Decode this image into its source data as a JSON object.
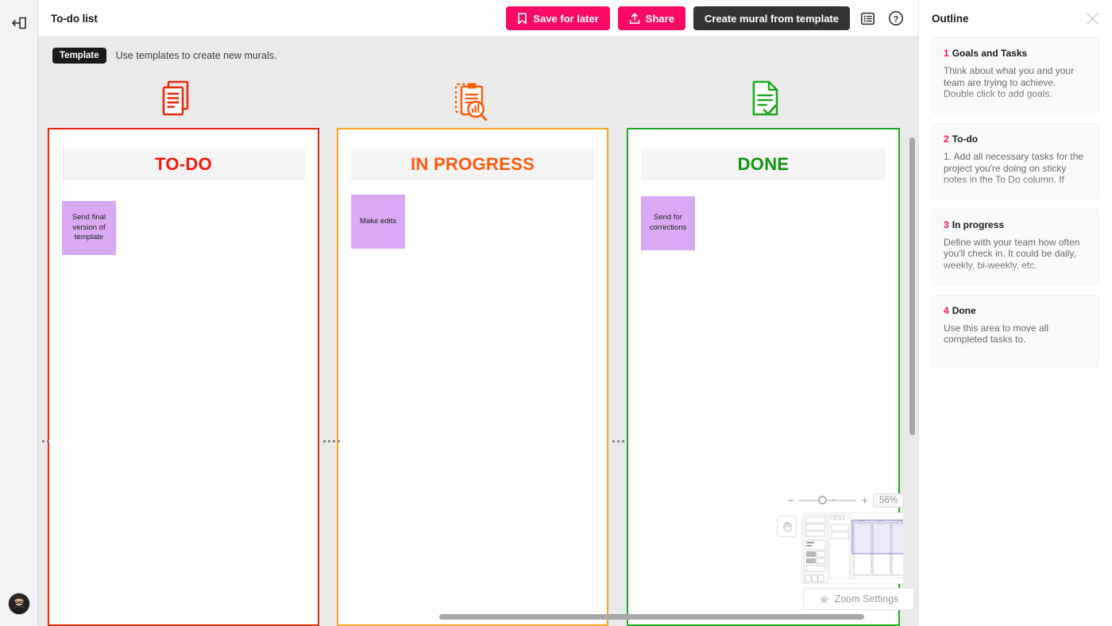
{
  "window": {
    "doc_title": "To-do list"
  },
  "left_rail": {
    "collapse_icon": "collapse-panel-icon",
    "avatar_alt": "user-avatar"
  },
  "toolbar": {
    "save_label": "Save for later",
    "save_icon": "bookmark-icon",
    "share_label": "Share",
    "share_icon": "upload-icon",
    "create_label": "Create mural from template",
    "outline_icon": "outline-list-icon",
    "help_icon": "question-mark-icon"
  },
  "template_bar": {
    "badge": "Template",
    "text": "Use templates to create new murals."
  },
  "board": {
    "icons": [
      {
        "name": "document-list-icon",
        "color": "#e52b0d"
      },
      {
        "name": "clipboard-analysis-icon",
        "color": "#fa5c10"
      },
      {
        "name": "document-check-icon",
        "color": "#21a821"
      }
    ],
    "columns": [
      {
        "title": "TO-DO",
        "border_color": "#e52b0d",
        "title_color": "#ed1c10",
        "stickies": [
          {
            "text": "Send final version of template",
            "color": "#d9aaf3"
          }
        ]
      },
      {
        "title": "IN PROGRESS",
        "border_color": "#f5a623",
        "title_color": "#fa5c10",
        "stickies": [
          {
            "text": "Make edits",
            "color": "#d9aaf3"
          }
        ]
      },
      {
        "title": "DONE",
        "border_color": "#21a821",
        "title_color": "#109610",
        "stickies": [
          {
            "text": "Send for corrections",
            "color": "#d9aaf3"
          }
        ]
      }
    ]
  },
  "zoom_widget": {
    "minus": "−",
    "plus": "+",
    "percent": "56%",
    "hand_icon": "pan-hand-icon",
    "settings_label": "Zoom Settings",
    "settings_icon": "gear-icon"
  },
  "outline": {
    "title": "Outline",
    "close_icon": "close-icon",
    "items": [
      {
        "number": "1",
        "title": "Goals and Tasks",
        "body": "Think about what you and your team are trying to achieve. Double click to add goals.",
        "truncated": true
      },
      {
        "number": "2",
        "title": "To-do",
        "body": "1. Add all necessary tasks for the project you're doing on sticky notes in the To Do column. If",
        "truncated": true
      },
      {
        "number": "3",
        "title": "In progress",
        "body": "Define with your team how often you'll check in. It could be daily, weekly, bi-weekly, etc.",
        "truncated": true
      },
      {
        "number": "4",
        "title": "Done",
        "body": "Use this area to move all completed tasks to.",
        "truncated": false
      }
    ]
  },
  "colors": {
    "accent_pink": "#fa0a64",
    "dark_button": "#333333",
    "canvas_bg": "#eaeaea",
    "sticky": "#d9aaf3"
  }
}
